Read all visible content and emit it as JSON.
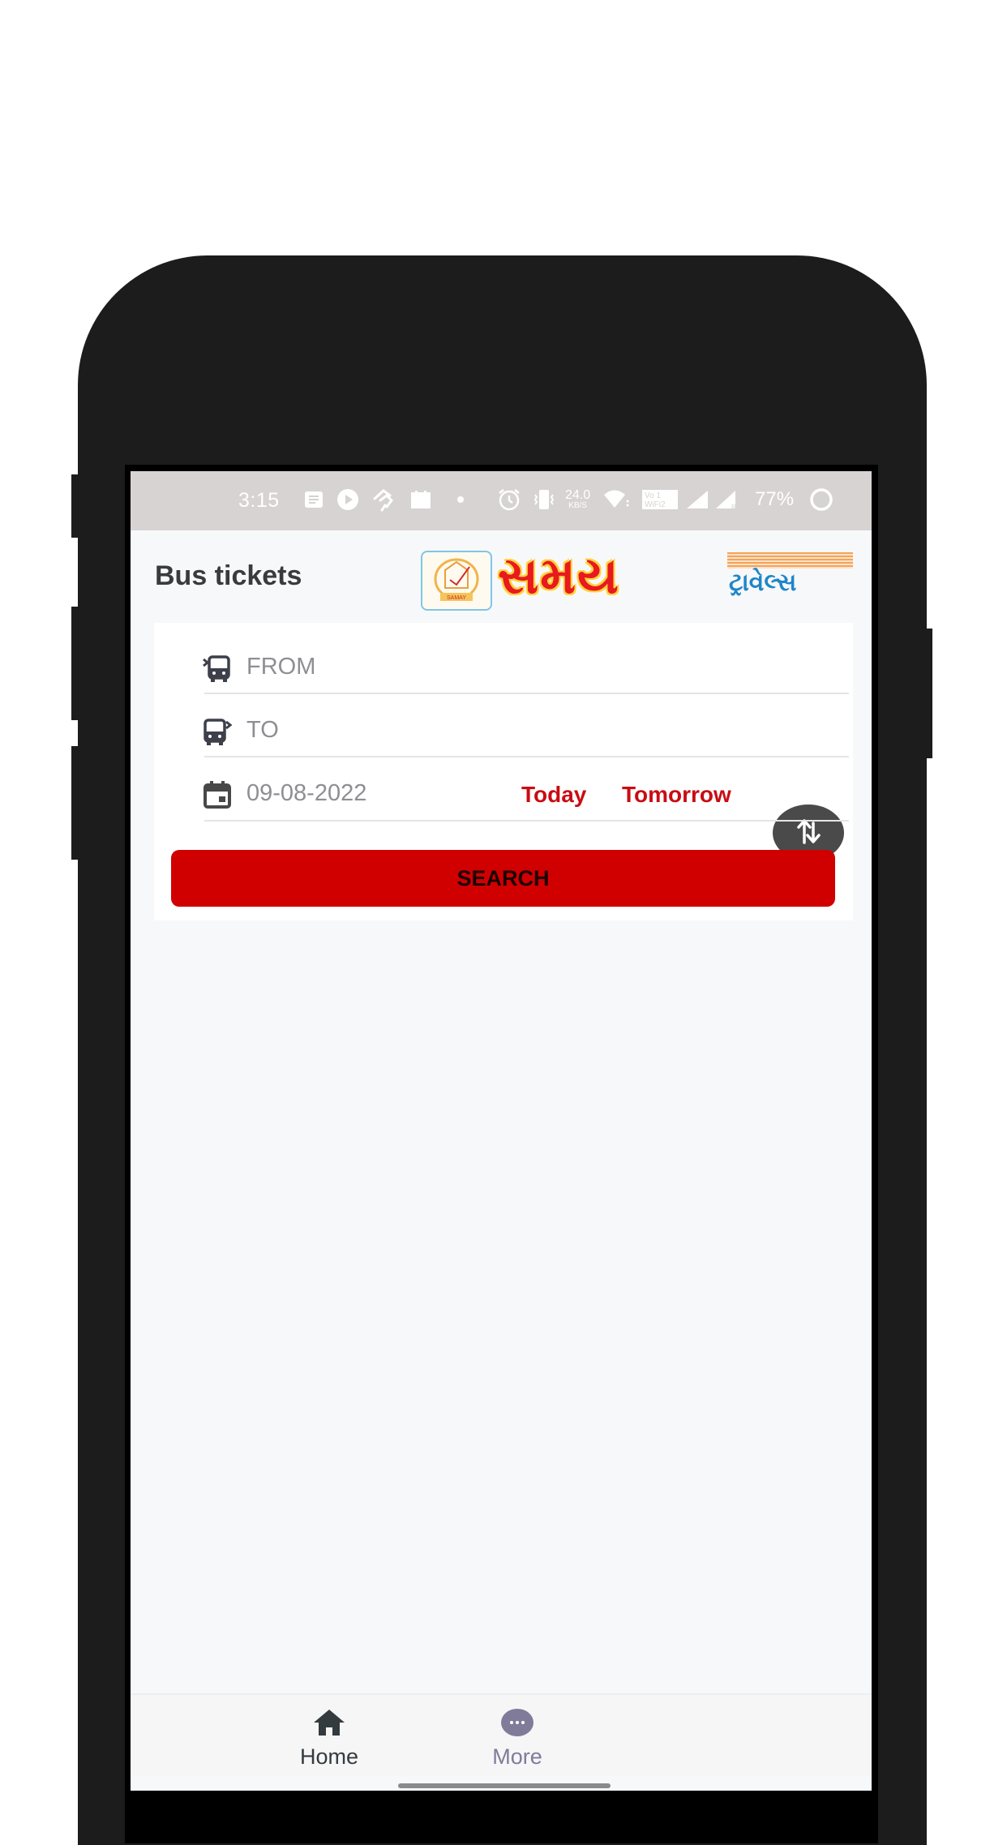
{
  "status_bar": {
    "time": "3:15",
    "network_speed": "24.0",
    "network_speed_unit": "KB/S",
    "volte_label": "Vo LTE",
    "wifi_label": "WiFi 2",
    "battery": "77%",
    "icons": [
      "message-icon",
      "youtube-icon",
      "hand-icon",
      "gallery-icon",
      "dot-icon",
      "alarm-icon",
      "vibrate-icon",
      "wifi-icon",
      "signal-icon",
      "signal-icon",
      "battery-ring-icon"
    ]
  },
  "header": {
    "title": "Bus tickets",
    "logo": {
      "brand_text": "સમય",
      "sub_text": "ટ્રાવેલ્સ",
      "emblem_text": "SAMAY",
      "brand_color": "#e8191f",
      "sub_color": "#1f86c9",
      "stripe_color": "#f3a35b"
    }
  },
  "search_form": {
    "from": {
      "placeholder": "FROM",
      "icon": "bus-depart-icon"
    },
    "to": {
      "placeholder": "TO",
      "icon": "bus-arrive-icon"
    },
    "date": {
      "value": "09-08-2022",
      "icon": "calendar-icon"
    },
    "today_label": "Today",
    "tomorrow_label": "Tomorrow",
    "swap_icon": "swap-vertical-icon",
    "search_label": "SEARCH",
    "accent_color": "#d10000"
  },
  "bottom_nav": {
    "items": [
      {
        "label": "Home",
        "icon": "home-icon",
        "active": true
      },
      {
        "label": "More",
        "icon": "more-icon",
        "active": false
      }
    ]
  }
}
